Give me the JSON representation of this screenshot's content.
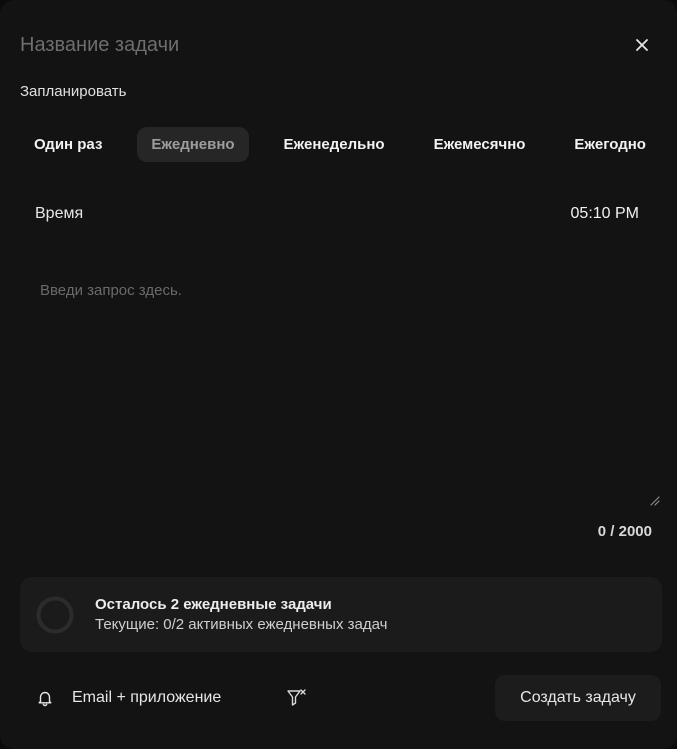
{
  "header": {
    "title_placeholder": "Название задачи",
    "close_icon": "close-icon"
  },
  "schedule": {
    "label": "Запланировать",
    "options": [
      "Один раз",
      "Ежедневно",
      "Еженедельно",
      "Ежемесячно",
      "Ежегодно"
    ],
    "selected": "Ежедневно"
  },
  "time": {
    "label": "Время",
    "value": "05:10 PM"
  },
  "prompt": {
    "placeholder": "Введи запрос здесь.",
    "value": "",
    "counter": "0 / 2000"
  },
  "quota": {
    "title": "Осталось 2 ежедневные задачи",
    "subtitle": "Текущие: 0/2 активных ежедневных задач",
    "used": 0,
    "total": 2
  },
  "footer": {
    "notify_label": "Email + приложение",
    "notify_icon": "bell-icon",
    "filter_icon": "filter-clear-icon",
    "create_label": "Создать задачу"
  },
  "colors": {
    "background": "#131313",
    "panel": "#1b1b1b",
    "active_option": "#262626",
    "text": "#e6e6e6",
    "muted": "#6e6e6e"
  }
}
